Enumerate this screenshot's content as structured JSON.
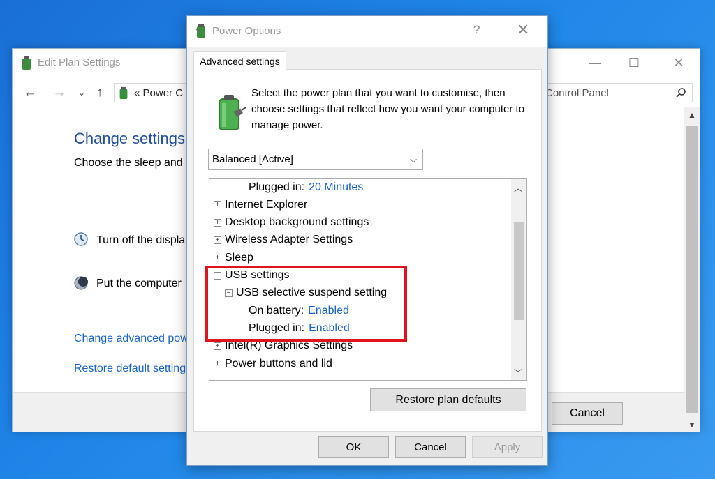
{
  "background_window": {
    "title": "Edit Plan Settings",
    "address_text": "« Power C",
    "search_text": "Control Panel",
    "heading": "Change settings",
    "subtext": "Choose the sleep and c",
    "display_label": "Turn off the displa",
    "sleep_label": "Put the computer",
    "link_advanced": "Change advanced pow",
    "link_restore": "Restore default settings",
    "cancel_label": "Cancel",
    "minimize_glyph": "—",
    "maximize_glyph": "☐",
    "close_glyph": "✕"
  },
  "dialog": {
    "title": "Power Options",
    "help_glyph": "?",
    "close_glyph": "✕",
    "tab_label": "Advanced settings",
    "description": "Select the power plan that you want to customise, then choose settings that reflect how you want your computer to manage power.",
    "plan_selected": "Balanced [Active]",
    "restore_label": "Restore plan defaults",
    "ok_label": "OK",
    "cancel_label": "Cancel",
    "apply_label": "Apply"
  },
  "tree": [
    {
      "label": "Plugged in:",
      "value": "20 Minutes",
      "level": 2
    },
    {
      "label": "Internet Explorer",
      "expander": "+",
      "level": 0
    },
    {
      "label": "Desktop background settings",
      "expander": "+",
      "level": 0
    },
    {
      "label": "Wireless Adapter Settings",
      "expander": "+",
      "level": 0
    },
    {
      "label": "Sleep",
      "expander": "+",
      "level": 0
    },
    {
      "label": "USB settings",
      "expander": "−",
      "level": 0
    },
    {
      "label": "USB selective suspend setting",
      "expander": "−",
      "level": 1
    },
    {
      "label": "On battery:",
      "value": "Enabled",
      "level": 2
    },
    {
      "label": "Plugged in:",
      "value": "Enabled",
      "level": 2
    },
    {
      "label": "Intel(R) Graphics Settings",
      "expander": "+",
      "level": 0
    },
    {
      "label": "Power buttons and lid",
      "expander": "+",
      "level": 0
    }
  ],
  "colors": {
    "link_blue": "#1a66c7",
    "highlight_red": "#e0141e"
  }
}
